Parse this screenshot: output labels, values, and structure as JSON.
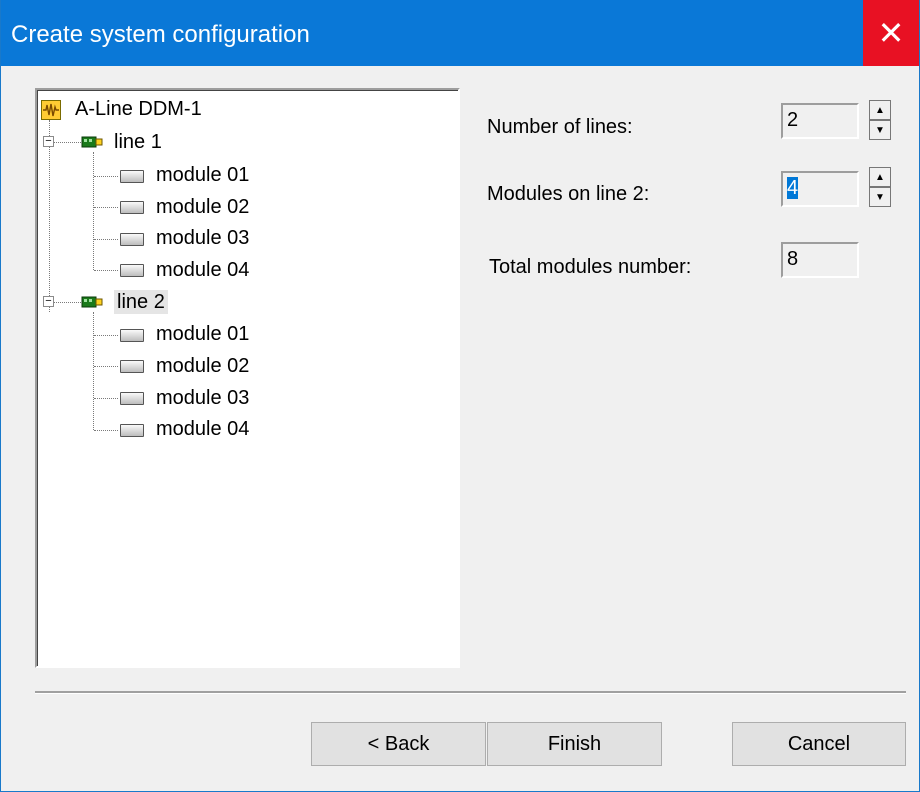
{
  "window": {
    "title": "Create system configuration",
    "close_glyph": "✕"
  },
  "tree": {
    "root": "A-Line DDM-1",
    "lines": [
      {
        "label": "line 1",
        "modules": [
          "module 01",
          "module 02",
          "module 03",
          "module 04"
        ]
      },
      {
        "label": "line 2",
        "modules": [
          "module 01",
          "module 02",
          "module 03",
          "module 04"
        ]
      }
    ],
    "collapse_glyph": "−"
  },
  "form": {
    "lines_label": "Number of lines:",
    "lines_value": "2",
    "modules_label": "Modules on line 2:",
    "modules_value": "4",
    "total_label": "Total modules number:",
    "total_value": "8",
    "spin_up": "▲",
    "spin_down": "▼"
  },
  "buttons": {
    "back": "< Back",
    "finish": "Finish",
    "cancel": "Cancel"
  }
}
